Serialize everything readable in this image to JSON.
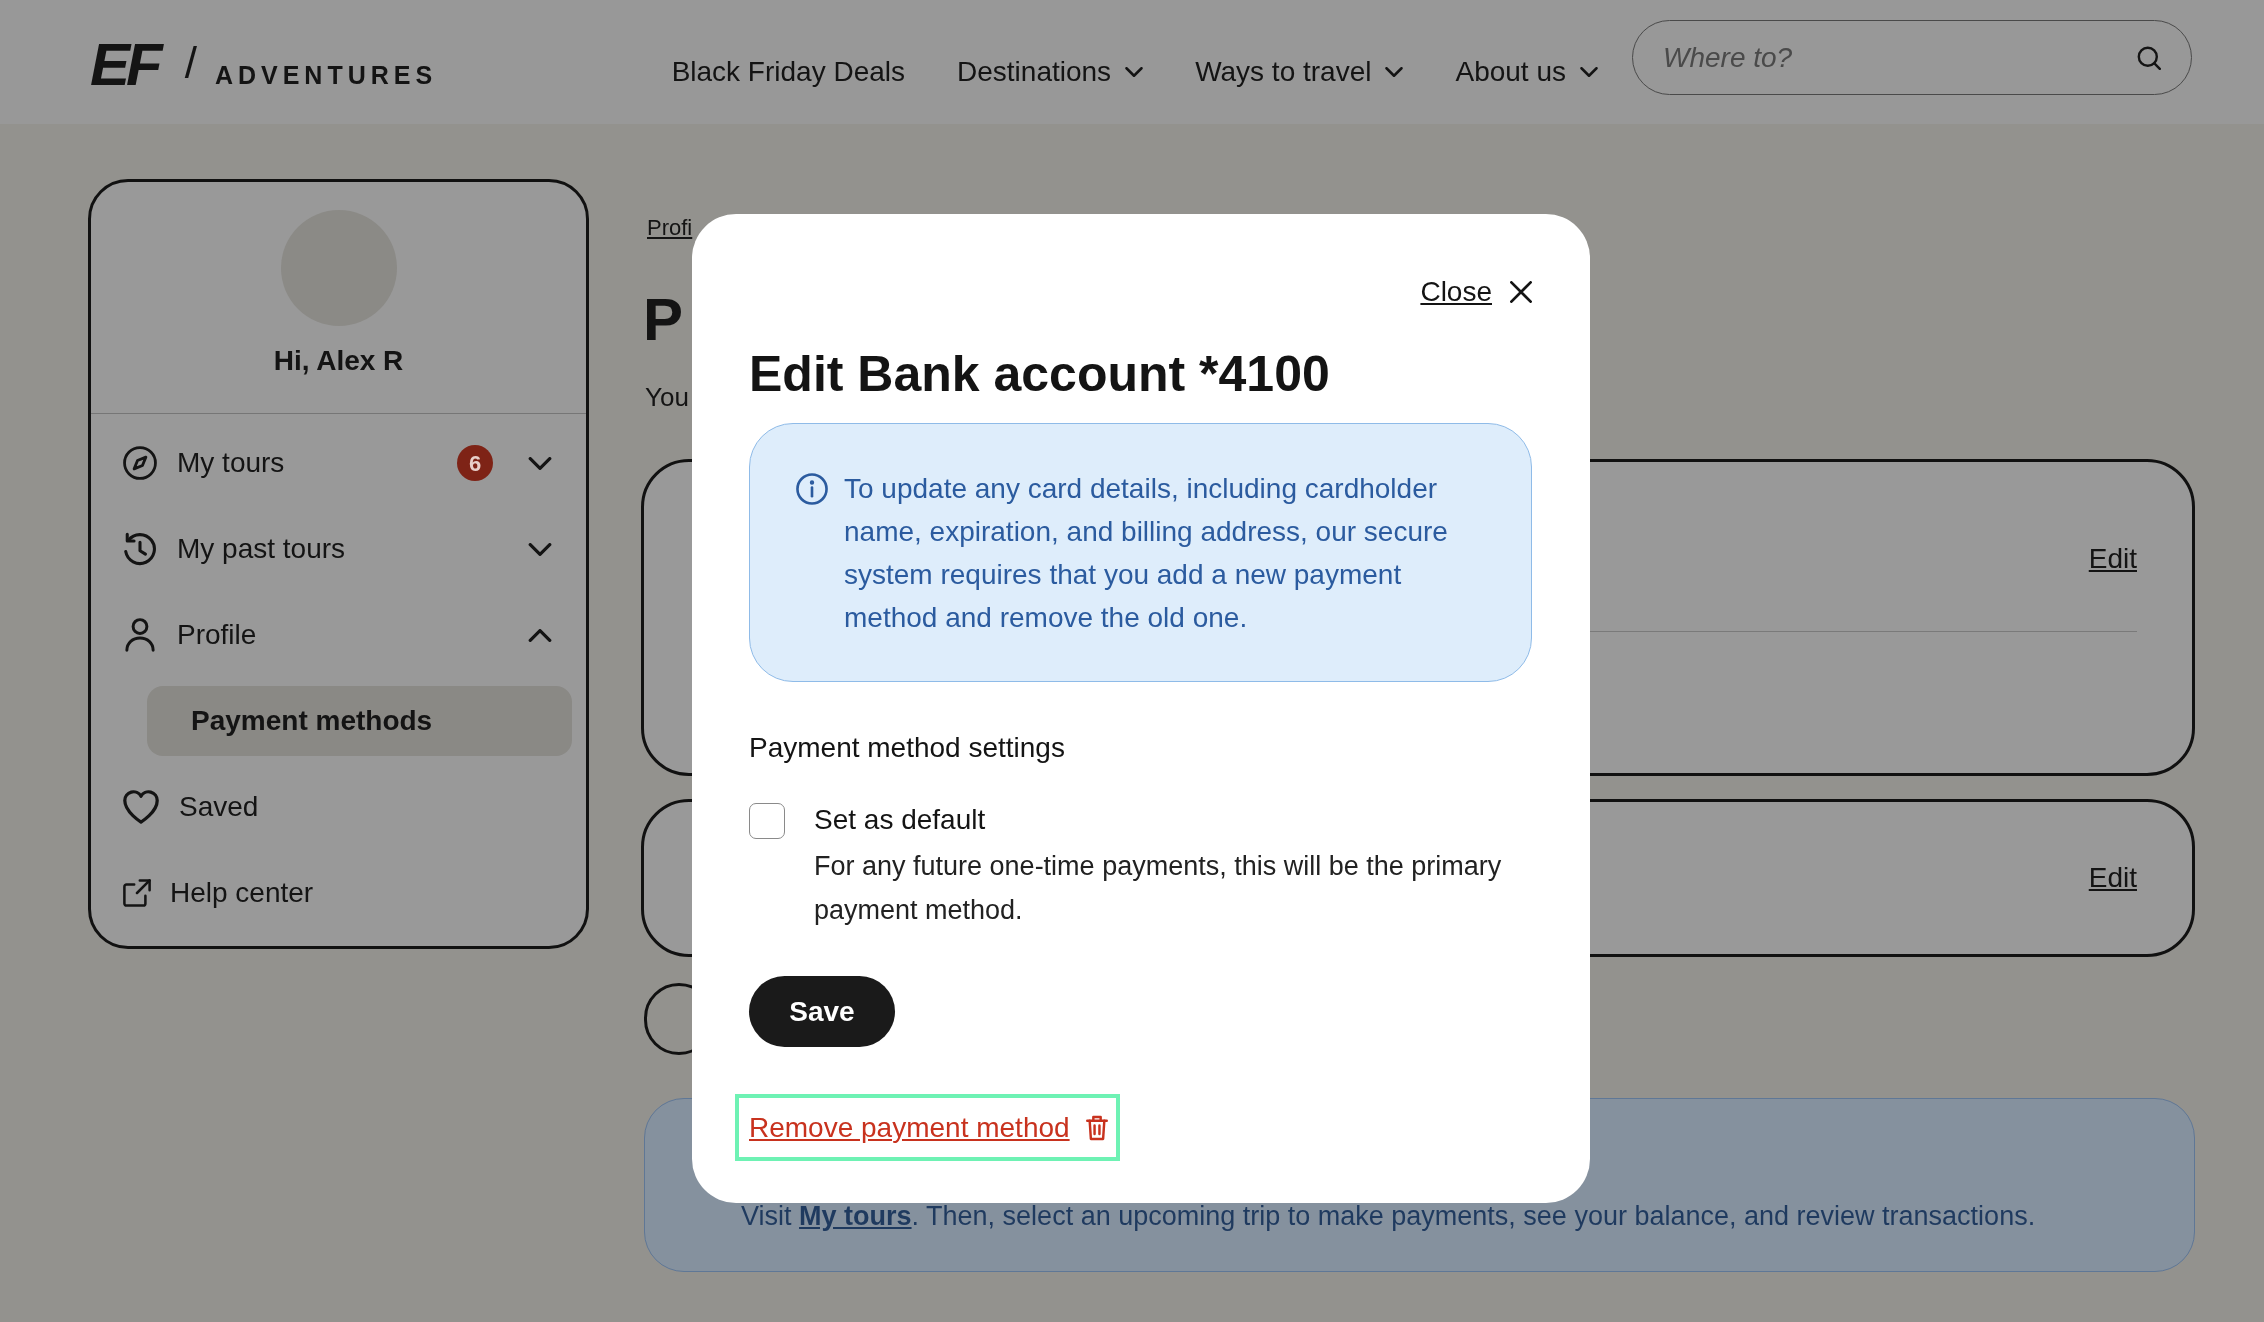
{
  "header": {
    "logo": {
      "mark": "EF",
      "separator": "/",
      "name": "ADVENTURES"
    },
    "nav": [
      {
        "label": "Black Friday Deals",
        "has_menu": false
      },
      {
        "label": "Destinations",
        "has_menu": true
      },
      {
        "label": "Ways to travel",
        "has_menu": true
      },
      {
        "label": "About us",
        "has_menu": true
      }
    ],
    "search": {
      "placeholder": "Where to?"
    }
  },
  "sidebar": {
    "greeting": "Hi, Alex R",
    "items": [
      {
        "label": "My tours",
        "kind": "group",
        "badge": "6",
        "expanded": false,
        "selected": false
      },
      {
        "label": "My past tours",
        "kind": "group",
        "expanded": false,
        "selected": false
      },
      {
        "label": "Profile",
        "kind": "group",
        "expanded": true,
        "selected": false,
        "children": [
          {
            "label": "Payment methods",
            "selected": true
          }
        ]
      },
      {
        "label": "Saved",
        "kind": "link",
        "selected": false
      },
      {
        "label": "Help center",
        "kind": "external_link",
        "selected": false
      }
    ]
  },
  "main": {
    "breadcrumb": "Profi",
    "heading": "P",
    "intro": "You",
    "cards": [
      {
        "action": "Edit",
        "divider": true
      },
      {
        "action": "Edit",
        "divider": false
      }
    ],
    "notice": {
      "before": "Visit ",
      "link": "My tours",
      "after": ". Then, select an upcoming trip to make payments, see your balance, and review transactions."
    }
  },
  "modal": {
    "close_label": "Close",
    "title": "Edit Bank account *4100",
    "info": "To update any card details, including cardholder name, expiration, and billing address, our secure system requires that you add a new payment method and remove the old one.",
    "section_title": "Payment method settings",
    "option": {
      "label": "Set as default",
      "description": "For any future one-time payments, this will be the primary payment method.",
      "checked": false
    },
    "save_label": "Save",
    "remove": {
      "label": "Remove payment method",
      "highlighted": true
    }
  }
}
